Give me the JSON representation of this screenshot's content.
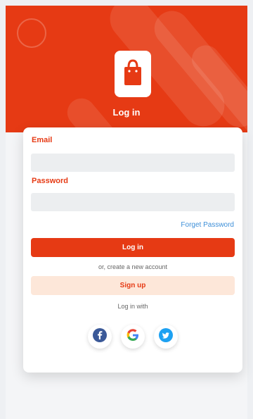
{
  "header": {
    "title": "Log in",
    "logo_icon": "shopping-bag-icon"
  },
  "form": {
    "email_label": "Email",
    "email_placeholder": "",
    "password_label": "Password",
    "password_placeholder": "",
    "forgot_password": "Forget Password"
  },
  "actions": {
    "login_label": "Log in",
    "or_create": "or, create a new account",
    "signup_label": "Sign up",
    "login_with": "Log in with"
  },
  "social": [
    {
      "icon": "facebook-icon"
    },
    {
      "icon": "google-icon"
    },
    {
      "icon": "twitter-icon"
    }
  ],
  "colors": {
    "accent": "#e63a14",
    "signup_bg": "#fde7d9",
    "link": "#3d8fd8",
    "facebook": "#3b5998",
    "twitter": "#1da1f2"
  }
}
